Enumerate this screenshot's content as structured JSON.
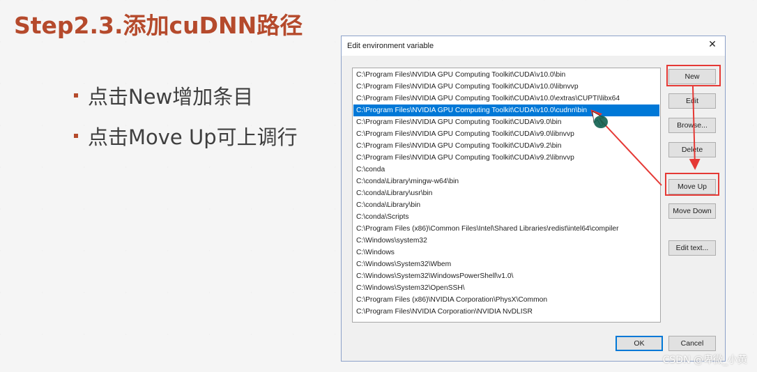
{
  "slide": {
    "title": "Step2.3.添加cuDNN路径",
    "bullets": [
      "点击New增加条目",
      "点击Move Up可上调行"
    ]
  },
  "dialog": {
    "title": "Edit environment variable",
    "close_glyph": "✕",
    "paths": [
      "C:\\Program Files\\NVIDIA GPU Computing Toolkit\\CUDA\\v10.0\\bin",
      "C:\\Program Files\\NVIDIA GPU Computing Toolkit\\CUDA\\v10.0\\libnvvp",
      "C:\\Program Files\\NVIDIA GPU Computing Toolkit\\CUDA\\v10.0\\extras\\CUPTI\\libx64",
      "C:\\Program Files\\NVIDIA GPU Computing Toolkit\\CUDA\\v10.0\\cudnn\\bin",
      "C:\\Program Files\\NVIDIA GPU Computing Toolkit\\CUDA\\v9.0\\bin",
      "C:\\Program Files\\NVIDIA GPU Computing Toolkit\\CUDA\\v9.0\\libnvvp",
      "C:\\Program Files\\NVIDIA GPU Computing Toolkit\\CUDA\\v9.2\\bin",
      "C:\\Program Files\\NVIDIA GPU Computing Toolkit\\CUDA\\v9.2\\libnvvp",
      "C:\\conda",
      "C:\\conda\\Library\\mingw-w64\\bin",
      "C:\\conda\\Library\\usr\\bin",
      "C:\\conda\\Library\\bin",
      "C:\\conda\\Scripts",
      "C:\\Program Files (x86)\\Common Files\\Intel\\Shared Libraries\\redist\\intel64\\compiler",
      "C:\\Windows\\system32",
      "C:\\Windows",
      "C:\\Windows\\System32\\Wbem",
      "C:\\Windows\\System32\\WindowsPowerShell\\v1.0\\",
      "C:\\Windows\\System32\\OpenSSH\\",
      "C:\\Program Files (x86)\\NVIDIA Corporation\\PhysX\\Common",
      "C:\\Program Files\\NVIDIA Corporation\\NVIDIA NvDLISR"
    ],
    "selected_index": 3,
    "buttons": {
      "new": "New",
      "edit": "Edit",
      "browse": "Browse...",
      "delete": "Delete",
      "move_up": "Move Up",
      "move_down": "Move Down",
      "edit_text": "Edit text...",
      "ok": "OK",
      "cancel": "Cancel"
    }
  },
  "watermark": "CSDN @卑微_小黄",
  "colors": {
    "title": "#b54a2c",
    "selection": "#0078d7",
    "annotation": "#e53935",
    "cursor": "#0f5f4f"
  }
}
